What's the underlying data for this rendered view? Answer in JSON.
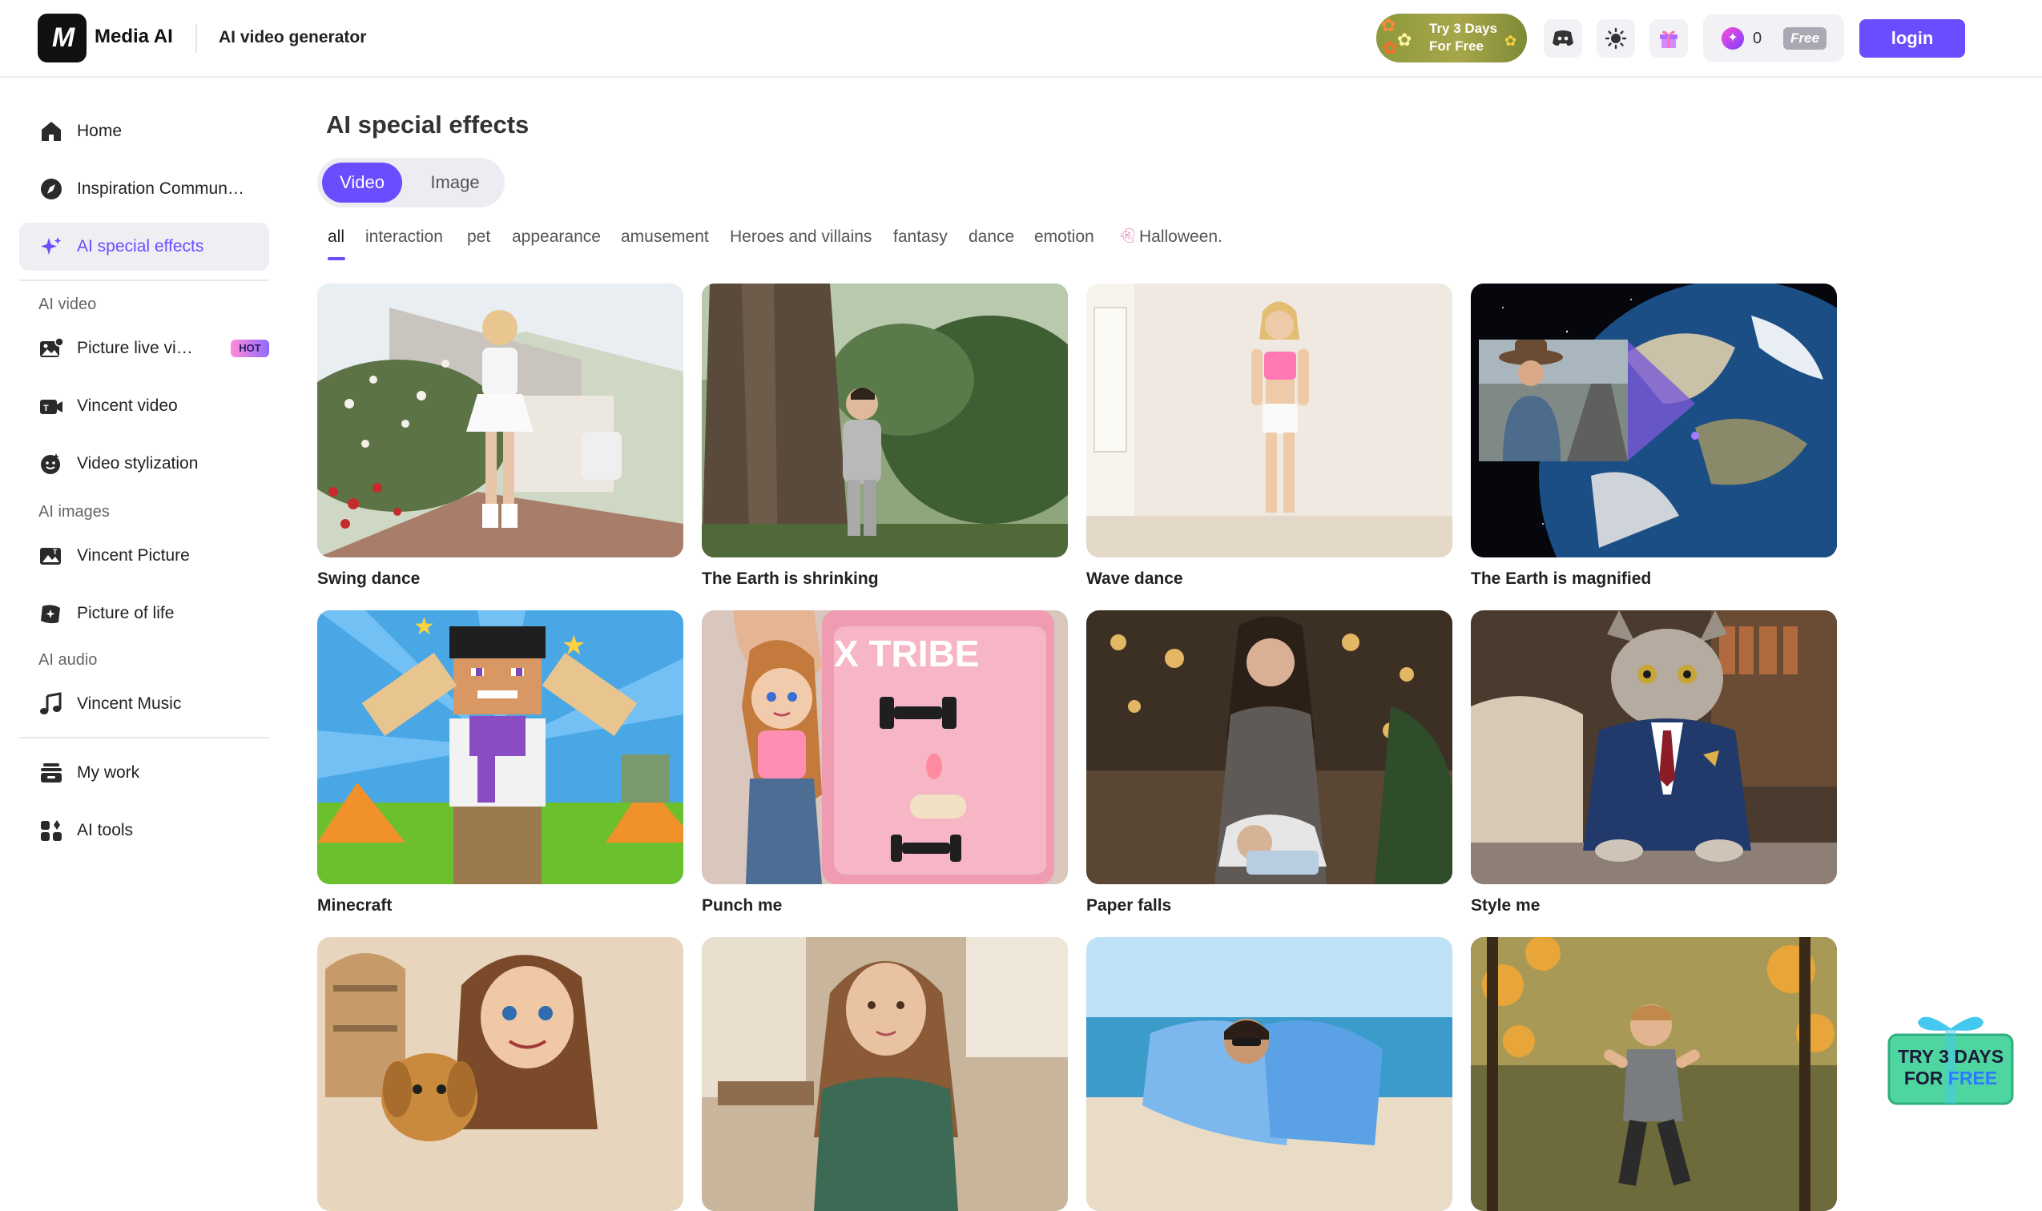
{
  "header": {
    "brand": "Media AI",
    "logo_text": "M",
    "subtitle": "AI video generator",
    "trial_line1": "Try 3 Days",
    "trial_line2": "For Free",
    "credits": "0",
    "plan": "Free",
    "login": "login"
  },
  "sidebar": {
    "items": [
      {
        "label": "Home",
        "icon": "home-icon"
      },
      {
        "label": "Inspiration Commun…",
        "icon": "compass-icon"
      },
      {
        "label": "AI special effects",
        "icon": "sparkle-icon"
      }
    ],
    "sections": [
      {
        "title": "AI video",
        "items": [
          {
            "label": "Picture live vi…",
            "icon": "image-video-icon",
            "badge": "HOT"
          },
          {
            "label": "Vincent video",
            "icon": "video-camera-icon"
          },
          {
            "label": "Video stylization",
            "icon": "face-style-icon"
          }
        ]
      },
      {
        "title": "AI images",
        "items": [
          {
            "label": "Vincent Picture",
            "icon": "picture-icon"
          },
          {
            "label": "Picture of life",
            "icon": "sparkle-picture-icon"
          }
        ]
      },
      {
        "title": "AI audio",
        "items": [
          {
            "label": "Vincent Music",
            "icon": "music-note-icon"
          }
        ]
      }
    ],
    "bottom_items": [
      {
        "label": "My work",
        "icon": "stack-icon"
      },
      {
        "label": "AI tools",
        "icon": "grid-tools-icon"
      }
    ]
  },
  "main": {
    "title": "AI special effects",
    "toggle": {
      "video": "Video",
      "image": "Image"
    },
    "categories": [
      "all",
      "interaction",
      "pet",
      "appearance",
      "amusement",
      "Heroes and villains",
      "fantasy",
      "dance",
      "emotion",
      "Halloween."
    ],
    "cards": [
      {
        "caption": "Swing dance"
      },
      {
        "caption": "The Earth is shrinking"
      },
      {
        "caption": "Wave dance"
      },
      {
        "caption": "The Earth is magnified"
      },
      {
        "caption": "Minecraft"
      },
      {
        "caption": "Punch me"
      },
      {
        "caption": "Paper falls"
      },
      {
        "caption": "Style me"
      },
      {
        "caption": ""
      },
      {
        "caption": ""
      },
      {
        "caption": ""
      },
      {
        "caption": ""
      }
    ],
    "punch_me_text": "X TRIBE"
  },
  "promo": {
    "line1": "TRY 3 DAYS",
    "line2a": "FOR ",
    "line2b": "FREE"
  },
  "colors": {
    "accent": "#6b4dff",
    "hot_badge": "#ff8ad8",
    "promo_green": "#4fd6a0"
  }
}
